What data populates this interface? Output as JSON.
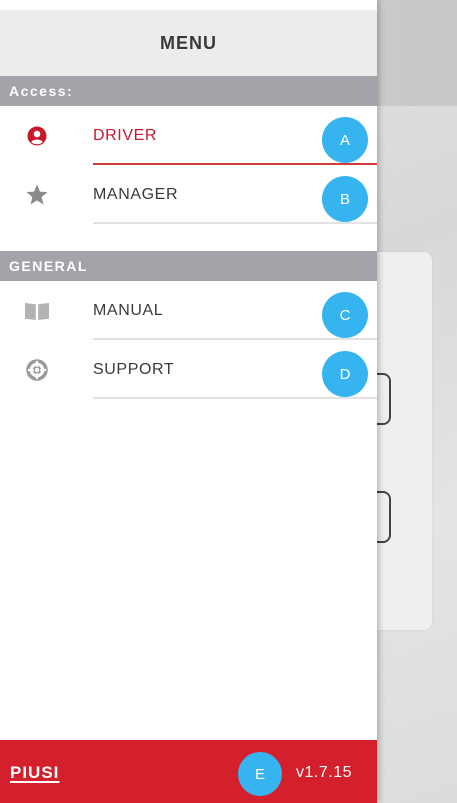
{
  "menu": {
    "title": "MENU"
  },
  "sections": {
    "access": {
      "label": "Access:",
      "items": [
        {
          "label": "DRIVER",
          "badge": "A",
          "icon": "person-circle-icon",
          "active": true
        },
        {
          "label": "MANAGER",
          "badge": "B",
          "icon": "star-icon",
          "active": false
        }
      ]
    },
    "general": {
      "label": "GENERAL",
      "items": [
        {
          "label": "MANUAL",
          "badge": "C",
          "icon": "book-icon"
        },
        {
          "label": "SUPPORT",
          "badge": "D",
          "icon": "lifebuoy-icon"
        }
      ]
    }
  },
  "footer": {
    "logo": "PIUSI",
    "badge": "E",
    "version": "v1.7.15"
  },
  "colors": {
    "accent_red": "#d4202c",
    "badge_blue": "#35b4f0",
    "section_gray": "#a3a4aa"
  }
}
